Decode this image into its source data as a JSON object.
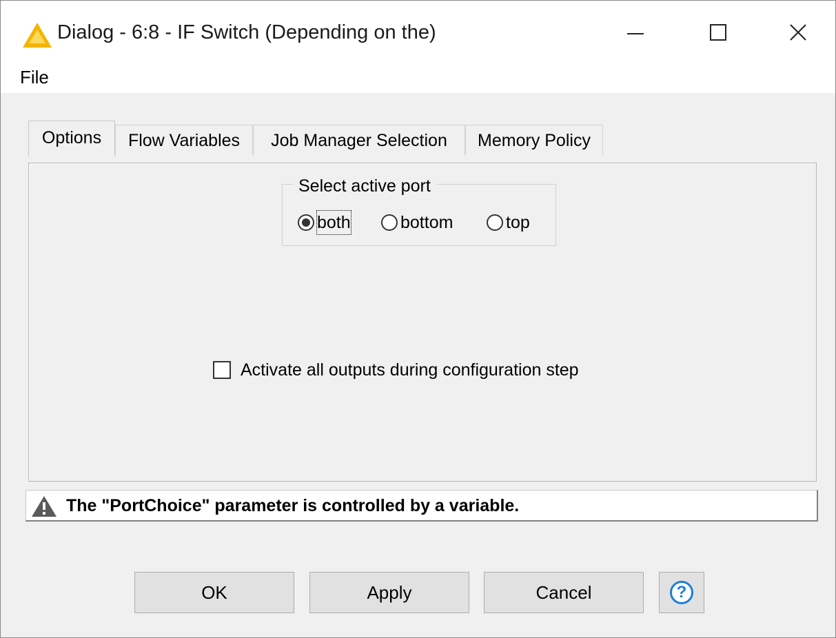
{
  "window": {
    "title": "Dialog - 6:8 - IF Switch (Depending on the)",
    "icon": "knime-warning-triangle-icon"
  },
  "menubar": {
    "items": [
      {
        "label": "File"
      }
    ]
  },
  "tabs": [
    {
      "label": "Options",
      "active": true
    },
    {
      "label": "Flow Variables",
      "active": false
    },
    {
      "label": "Job Manager Selection",
      "active": false
    },
    {
      "label": "Memory Policy",
      "active": false
    }
  ],
  "options": {
    "group_label": "Select active port",
    "radios": [
      {
        "label": "both",
        "selected": true
      },
      {
        "label": "bottom",
        "selected": false
      },
      {
        "label": "top",
        "selected": false
      }
    ],
    "checkbox": {
      "label": "Activate all outputs during configuration step",
      "checked": false
    }
  },
  "warning": {
    "text": "The \"PortChoice\" parameter is controlled by a variable."
  },
  "buttons": {
    "ok": "OK",
    "apply": "Apply",
    "cancel": "Cancel",
    "help": "?"
  },
  "colors": {
    "help_blue": "#1a7fd8",
    "warning_yellow": "#f5b400"
  }
}
